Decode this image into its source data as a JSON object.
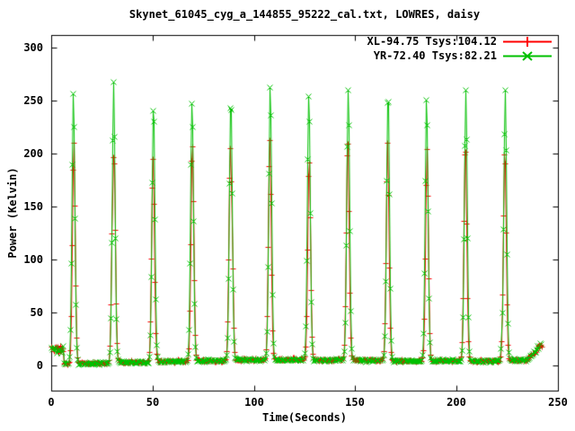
{
  "window": {
    "background": "#ffffff"
  },
  "chart_data": {
    "type": "line",
    "title": "Skynet_61045_cyg_a_144855_95222_cal.txt, LOWRES, daisy",
    "xlabel": "Time(Seconds)",
    "ylabel": "Power (Kelvin)",
    "xlim": [
      0,
      250
    ],
    "ylim": [
      -24,
      312
    ],
    "xticks": [
      0,
      50,
      100,
      150,
      200,
      250
    ],
    "yticks": [
      0,
      50,
      100,
      150,
      200,
      250,
      300
    ],
    "grid": false,
    "legend_position": "top-right-inside",
    "frame_color": "#000000",
    "text_color": "#000000",
    "sampling": {
      "interval_s": 0.45,
      "t_start_s": 0,
      "t_end_s": 242
    },
    "peak_times_s": [
      10.9,
      30.6,
      50.1,
      69.4,
      88.4,
      107.7,
      127.0,
      146.3,
      165.8,
      185.1,
      204.3,
      223.6
    ],
    "peak_sigma_s": 1.0,
    "baseline_levels_K": [
      1.5,
      2.0,
      3.0,
      3.8,
      4.5,
      5.2,
      5.6,
      5.2,
      4.8,
      4.2,
      4.5,
      4.2,
      5.0
    ],
    "baseline_noise_K": 1.2,
    "start_cluster": {
      "t_end_s": 6,
      "mean_K": 14,
      "spread_K": 9
    },
    "end_tail": {
      "t_start_s": 234.5,
      "slope_K_per_s": 2.2,
      "cluster_mean_K": 20
    },
    "series": [
      {
        "name": "XL",
        "label": "XL-94.75 Tsys:104.12",
        "color": "#ff0000",
        "marker": "plus",
        "time_offset_s": 0.22,
        "peak_heights_K": [
          205,
          200,
          196,
          208,
          203,
          206,
          190,
          204,
          200,
          197,
          206,
          201
        ]
      },
      {
        "name": "YR",
        "label": "YR-72.40 Tsys:82.21",
        "color": "#00c000",
        "marker": "cross",
        "time_offset_s": 0,
        "peak_heights_K": [
          258,
          259,
          243,
          252,
          250,
          260,
          256,
          257,
          253,
          249,
          254,
          252
        ]
      }
    ]
  }
}
